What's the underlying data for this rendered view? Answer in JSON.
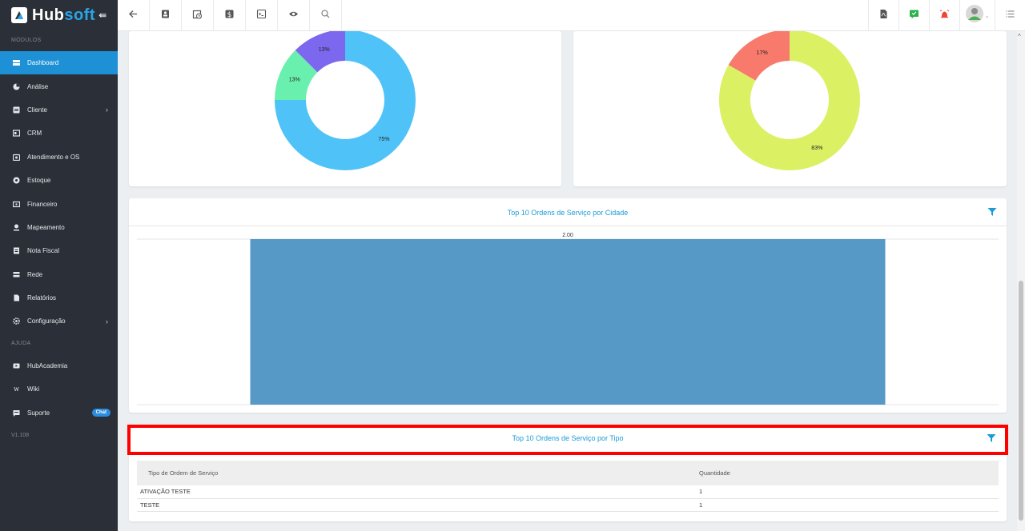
{
  "brand": {
    "name_part1": "Hub",
    "name_part2": "soft",
    "collapse_glyph": "⇚"
  },
  "sidebar": {
    "section_modules": "MÓDULOS",
    "items": [
      {
        "label": "Dashboard",
        "icon": "dashboard-icon",
        "active": true
      },
      {
        "label": "Análise",
        "icon": "analysis-icon"
      },
      {
        "label": "Cliente",
        "icon": "client-icon",
        "chevron": "›"
      },
      {
        "label": "CRM",
        "icon": "crm-icon"
      },
      {
        "label": "Atendimento e OS",
        "icon": "service-icon"
      },
      {
        "label": "Estoque",
        "icon": "stock-icon"
      },
      {
        "label": "Financeiro",
        "icon": "finance-icon"
      },
      {
        "label": "Mapeamento",
        "icon": "map-pin-icon"
      },
      {
        "label": "Nota Fiscal",
        "icon": "invoice-icon"
      },
      {
        "label": "Rede",
        "icon": "network-icon"
      },
      {
        "label": "Relatórios",
        "icon": "reports-icon"
      },
      {
        "label": "Configuração",
        "icon": "gear-icon",
        "chevron": "›"
      }
    ],
    "section_help": "AJUDA",
    "help_items": [
      {
        "label": "HubAcademia",
        "icon": "video-icon"
      },
      {
        "label": "Wiki",
        "icon": "wiki-icon"
      },
      {
        "label": "Suporte",
        "icon": "support-icon",
        "badge": "Chat"
      }
    ],
    "version": "V1.108"
  },
  "topbar": {
    "left_icons": [
      "back-arrow-icon",
      "contact-card-icon",
      "calendar-clock-icon",
      "dollar-icon",
      "terminal-icon",
      "eye-icon",
      "search-icon"
    ],
    "right_icons": [
      "pdf-icon",
      "check-message-icon",
      "alarm-bell-icon",
      "avatar",
      "list-menu-icon"
    ]
  },
  "donut_left": {
    "slices": [
      {
        "label": "75%",
        "value": 75,
        "color": "#4fc3f7"
      },
      {
        "label": "13%",
        "value": 12.5,
        "color": "#69f0ae"
      },
      {
        "label": "13%",
        "value": 12.5,
        "color": "#7b68ee"
      }
    ]
  },
  "donut_right": {
    "slices": [
      {
        "label": "83%",
        "value": 83.3,
        "color": "#dcf064"
      },
      {
        "label": "17%",
        "value": 16.7,
        "color": "#f77a6c"
      }
    ]
  },
  "city_card": {
    "title": "Top 10 Ordens de Serviço por Cidade"
  },
  "chart_data": {
    "type": "bar",
    "categories": [
      ""
    ],
    "values": [
      2
    ],
    "value_label": "2.00",
    "ylim": [
      0,
      2
    ],
    "color": "#5699c7"
  },
  "type_card": {
    "title": "Top 10 Ordens de Serviço por Tipo",
    "columns": [
      "Tipo de Ordem de Serviço",
      "Quantidade"
    ],
    "rows": [
      [
        "ATIVAÇÃO TESTE",
        "1"
      ],
      [
        "TESTE",
        "1"
      ]
    ]
  }
}
